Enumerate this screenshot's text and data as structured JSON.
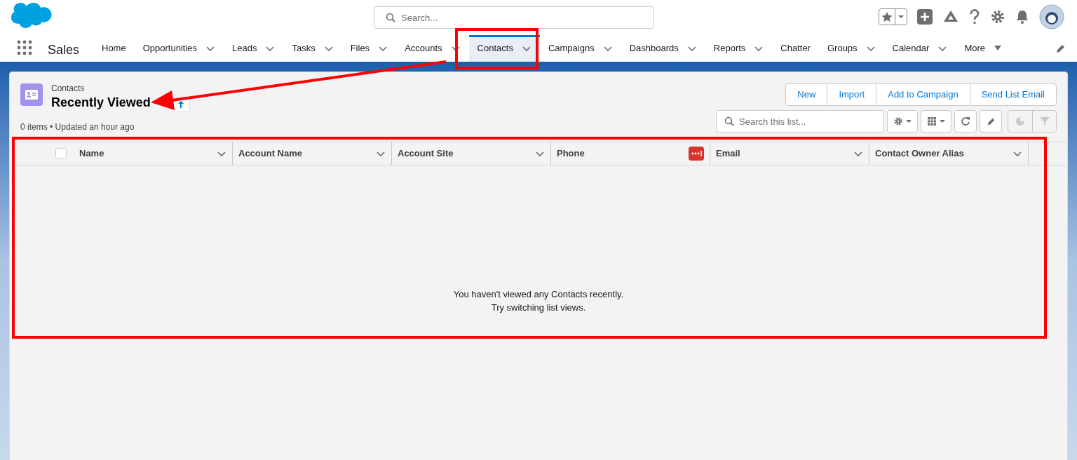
{
  "header": {
    "search": {
      "placeholder": "Search..."
    }
  },
  "app": {
    "name": "Sales"
  },
  "nav": [
    {
      "label": "Home",
      "menu": false,
      "selected": false
    },
    {
      "label": "Opportunities",
      "menu": true,
      "selected": false
    },
    {
      "label": "Leads",
      "menu": true,
      "selected": false
    },
    {
      "label": "Tasks",
      "menu": true,
      "selected": false
    },
    {
      "label": "Files",
      "menu": true,
      "selected": false
    },
    {
      "label": "Accounts",
      "menu": true,
      "selected": false
    },
    {
      "label": "Contacts",
      "menu": true,
      "selected": true
    },
    {
      "label": "Campaigns",
      "menu": true,
      "selected": false
    },
    {
      "label": "Dashboards",
      "menu": true,
      "selected": false
    },
    {
      "label": "Reports",
      "menu": true,
      "selected": false
    },
    {
      "label": "Chatter",
      "menu": false,
      "selected": false
    },
    {
      "label": "Groups",
      "menu": true,
      "selected": false
    },
    {
      "label": "Calendar",
      "menu": true,
      "selected": false
    }
  ],
  "more": {
    "label": "More"
  },
  "list_view": {
    "object": "Contacts",
    "title": "Recently Viewed",
    "status": "0 items • Updated an hour ago",
    "actions": [
      "New",
      "Import",
      "Add to Campaign",
      "Send List Email"
    ],
    "search": {
      "placeholder": "Search this list..."
    },
    "select_all": {
      "checked": false
    },
    "columns": [
      "Name",
      "Account Name",
      "Account Site",
      "Phone",
      "Email",
      "Contact Owner Alias"
    ],
    "empty": [
      "You haven't viewed any Contacts recently.",
      "Try switching list views."
    ]
  }
}
